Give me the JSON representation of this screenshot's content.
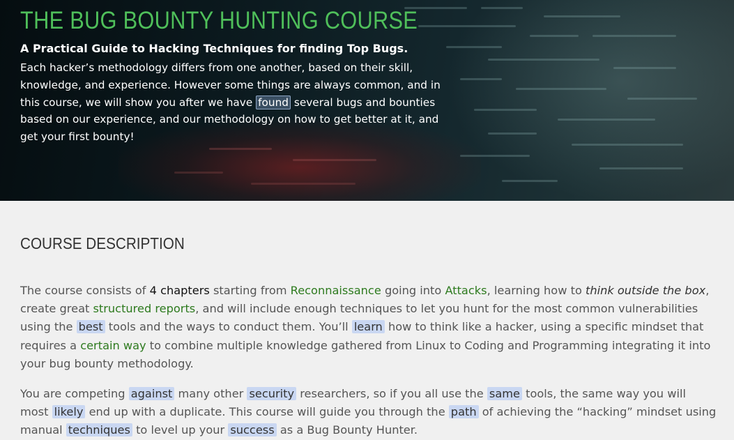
{
  "hero": {
    "title": "THE BUG BOUNTY HUNTING COURSE",
    "subtitle": "A Practical Guide to Hacking Techniques for finding Top Bugs.",
    "text_1": "Each hacker’s methodology differs from one another, based on their skill, knowledge, and experience. However some things are always common, and in this course, we will show you after we have ",
    "found": "found",
    "text_2": " several bugs and bounties based on our experience, and our methodology on how to get better at it, and get your first bounty!"
  },
  "course": {
    "section_title": "COURSE DESCRIPTION",
    "p1": {
      "t1": "The course consists of ",
      "chapters": "4 chapters",
      "t2": " starting from ",
      "recon": "Reconnaissance",
      "t3": " going into ",
      "attacks": "Attacks",
      "t4": ", learning how to ",
      "think": "think outside the box",
      "t5": ", create great ",
      "reports": "structured reports",
      "t6": ", and will include enough techniques to let you hunt for the most common vulnerabilities using the ",
      "best": "best",
      "t7": " tools and the ways to conduct them. You’ll ",
      "learn": "learn",
      "t8": " how to think like a hacker, using a specific mindset that requires a ",
      "certain": "certain way",
      "t9": " to combine multiple knowledge gathered from Linux to Coding and Programming integrating it into your bug bounty methodology."
    },
    "p2": {
      "t1": "You are competing ",
      "against": "against",
      "t2": " many other ",
      "security": "security",
      "t3": " researchers, so if you all use the ",
      "same": "same",
      "t4": " tools, the same way you will most ",
      "likely": "likely",
      "t5": " end up with a duplicate. This course will guide you through the ",
      "path": "path",
      "t6": " of achieving the “hacking” mindset using manual ",
      "techniques": "techniques",
      "t7": " to level up your ",
      "success": "success",
      "t8": " as a Bug Bounty Hunter."
    }
  },
  "colors": {
    "title_green": "#4fbf5a",
    "link_green": "#2d7a1e",
    "highlight": "#c9d7f2"
  }
}
